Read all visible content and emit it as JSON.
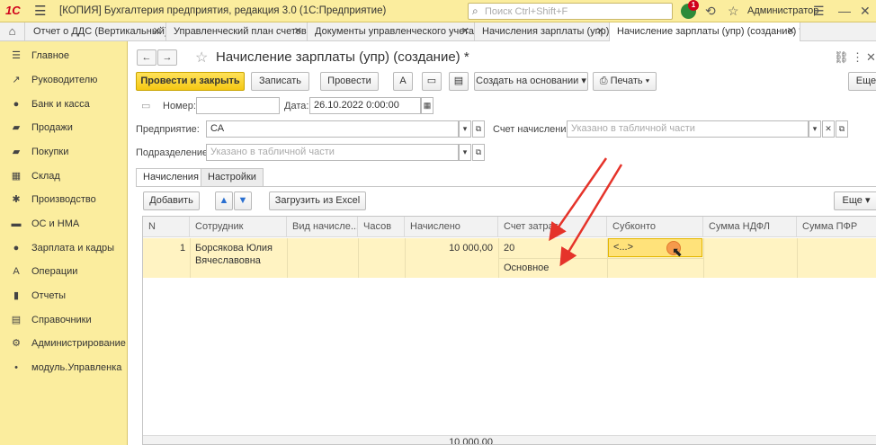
{
  "titlebar": {
    "logo": "1С",
    "title": "[КОПИЯ] Бухгалтерия предприятия, редакция 3.0  (1С:Предприятие)",
    "search_placeholder": "Поиск Ctrl+Shift+F",
    "notification_count": "1",
    "user": "Администратор"
  },
  "tabs": [
    {
      "label": "Отчет о ДДС (Вертикальный)",
      "close": "✕"
    },
    {
      "label": "Управленческий план счетов",
      "close": "✕"
    },
    {
      "label": "Документы управленческого учета",
      "close": "✕"
    },
    {
      "label": "Начисления зарплаты (упр)",
      "close": "✕"
    },
    {
      "label": "Начисление зарплаты (упр) (создание) *",
      "close": "✕"
    }
  ],
  "sidebar": {
    "items": [
      {
        "label": "Главное",
        "icon": "menu-icon"
      },
      {
        "label": "Руководителю",
        "icon": "chart-line-icon"
      },
      {
        "label": "Банк и касса",
        "icon": "coin-icon"
      },
      {
        "label": "Продажи",
        "icon": "cart-icon"
      },
      {
        "label": "Покупки",
        "icon": "basket-icon"
      },
      {
        "label": "Склад",
        "icon": "warehouse-icon"
      },
      {
        "label": "Производство",
        "icon": "factory-icon"
      },
      {
        "label": "ОС и НМА",
        "icon": "truck-icon"
      },
      {
        "label": "Зарплата и кадры",
        "icon": "person-icon"
      },
      {
        "label": "Операции",
        "icon": "operations-icon"
      },
      {
        "label": "Отчеты",
        "icon": "report-icon"
      },
      {
        "label": "Справочники",
        "icon": "book-icon"
      },
      {
        "label": "Администрирование",
        "icon": "gear-icon"
      },
      {
        "label": "модуль.Управленка",
        "icon": "dot-icon"
      }
    ]
  },
  "form": {
    "title": "Начисление зарплаты (упр) (создание) *",
    "buttons": {
      "post_close": "Провести и закрыть",
      "save": "Записать",
      "post": "Провести",
      "create_based": "Создать на основании",
      "print": "Печать",
      "more": "Еще"
    },
    "number_label": "Номер:",
    "number_value": "",
    "date_label": "Дата:",
    "date_value": "26.10.2022  0:00:00",
    "enterprise_label": "Предприятие:",
    "enterprise_value": "СА",
    "account_label": "Счет начисления:",
    "account_placeholder": "Указано в табличной части",
    "department_label": "Подразделение:",
    "department_placeholder": "Указано в табличной части",
    "form_tabs": [
      "Начисления",
      "Настройки"
    ],
    "table_toolbar": {
      "add": "Добавить",
      "load_excel": "Загрузить из Excel",
      "more": "Еще"
    }
  },
  "table": {
    "columns": [
      "N",
      "Сотрудник",
      "Вид начисле...",
      "Часов",
      "Начислено",
      "Счет затрат",
      "Субконто",
      "Сумма НДФЛ",
      "Сумма ПФР"
    ],
    "rows": [
      {
        "n": "1",
        "employee_line1": "Борсякова Юлия",
        "employee_line2": "Вячеславовна",
        "accrual_type": "",
        "hours": "",
        "amount": "10 000,00",
        "cost_account": "20",
        "cost_subaccount": "Основное",
        "subconto": "<...>",
        "ndfl": "",
        "pfr": ""
      }
    ],
    "total_amount": "10 000,00"
  },
  "colors": {
    "accent_yellow": "#fbed9e",
    "selected_row": "#fff3c2",
    "arrow_red": "#e5332a",
    "primary_button": "#f5c813"
  }
}
